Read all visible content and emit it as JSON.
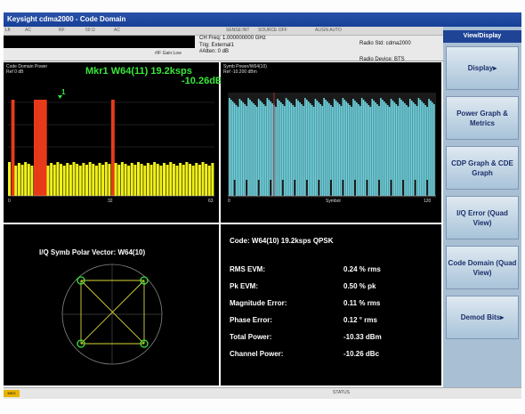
{
  "window_title": "Keysight cdma2000 - Code Domain",
  "header": {
    "cells": [
      "Lft",
      "AC",
      "RF",
      "50 Ω",
      "AC",
      "SENSE:INT",
      "SOURCE OFF",
      "ALIGN AUTO"
    ],
    "ch_freq": "CH Freq: 1.000000000 GHz",
    "trig": "Trig: External1",
    "atten": "#Atten: 0 dB",
    "radio_std": "Radio Std: cdma2000",
    "radio_device": "Radio Device: BTS",
    "softlabel": "#IF Gain:Low"
  },
  "panes": {
    "cdp": {
      "title": "Code Domain Power",
      "ref": "Ref 0 dB",
      "marker_label": "Mkr1 W64(11) 19.2ksps",
      "marker_value": "-10.26dB",
      "marker_flag": "1",
      "x_ticks": [
        "0",
        "32",
        "63"
      ]
    },
    "sym": {
      "title": "Symb Power/W64(10)",
      "ref": "Ref -10.200 dBm",
      "x_label": "Symbol",
      "x_ticks": [
        "0",
        "120"
      ]
    },
    "iq": {
      "title": "I/Q Symb Polar Vector: W64(10)"
    },
    "metrics": {
      "code_line": "Code:    W64(10) 19.2ksps QPSK",
      "rows": [
        {
          "label": "RMS EVM:",
          "value": "0.24 % rms"
        },
        {
          "label": "Pk EVM:",
          "value": "0.50 % pk"
        },
        {
          "label": "Magnitude Error:",
          "value": "0.11 % rms"
        },
        {
          "label": "Phase Error:",
          "value": "0.12 ° rms"
        },
        {
          "label": "Total Power:",
          "value": "-10.33 dBm"
        },
        {
          "label": "Channel Power:",
          "value": "-10.26 dBc"
        }
      ]
    }
  },
  "right_panel": {
    "title": "View/Display",
    "keys": [
      "Display▸",
      "Power Graph & Metrics",
      "CDP Graph & CDE Graph",
      "I/Q Error (Quad View)",
      "Code Domain (Quad View)",
      "Demod Bits▸"
    ]
  },
  "status": {
    "icon_text": "MSG",
    "label": "STATUS"
  },
  "chart_data": [
    {
      "type": "bar",
      "title": "Code Domain Power",
      "note": "64 Walsh codes; active codes shown in red, inactive in yellow",
      "x_ticks": [
        "0",
        "32",
        "63"
      ],
      "series": [
        {
          "name": "inactive codes",
          "color": "#f1f11a",
          "level": "low"
        },
        {
          "name": "active codes",
          "color": "#e83a1a",
          "codes": [
            1,
            8,
            9,
            10,
            11,
            32
          ],
          "level": "high"
        }
      ]
    },
    {
      "type": "bar",
      "title": "Symb Power/W64(10)",
      "xlabel": "Symbol",
      "x_ticks": [
        "0",
        "120"
      ],
      "series_color": "#6fd3df"
    }
  ]
}
